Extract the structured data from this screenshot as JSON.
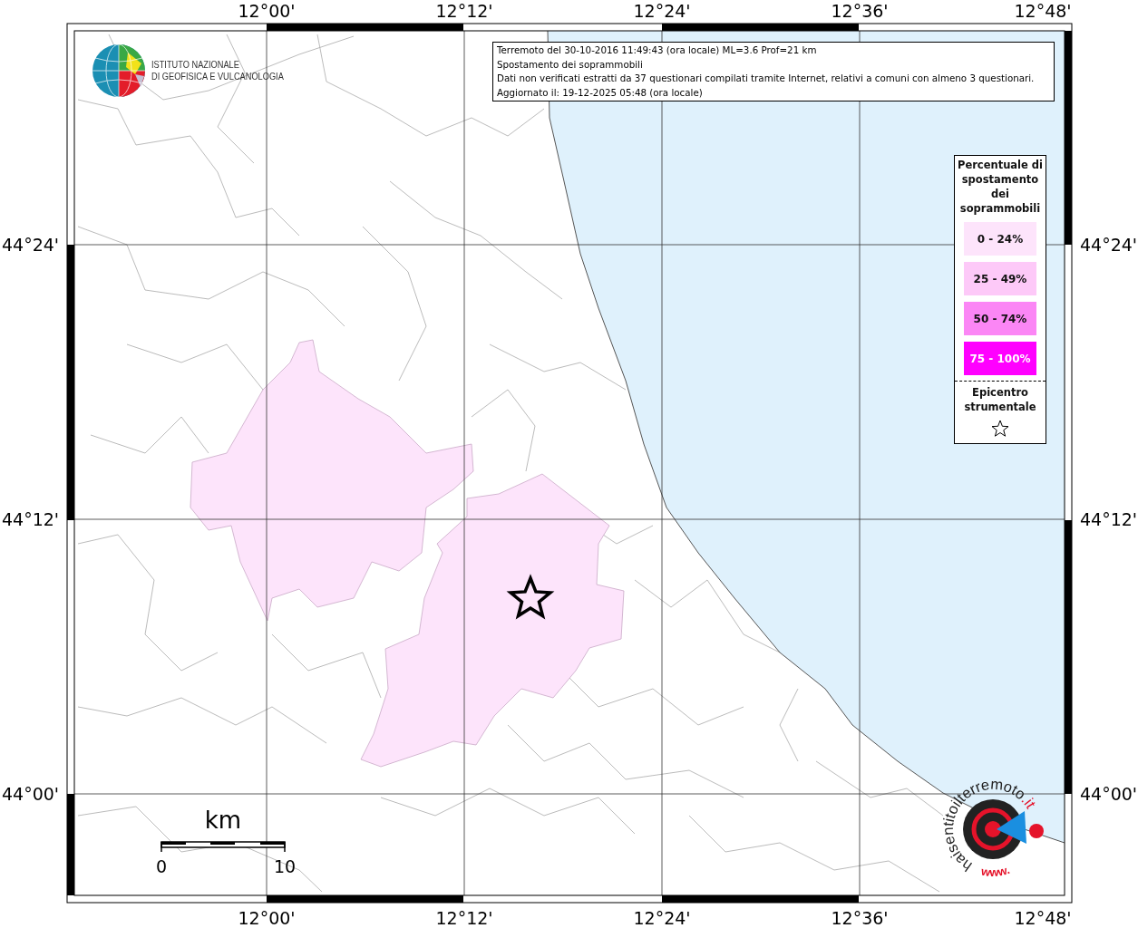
{
  "map": {
    "x_labels_top": [
      "12°00'",
      "12°12'",
      "12°24'",
      "12°36'",
      "12°48'"
    ],
    "y_labels_left": [
      "44°24'",
      "44°12'",
      "44°00'"
    ],
    "y_labels_right": [
      "44°24'",
      "44°12'",
      "44°00'"
    ],
    "x_labels_bottom": [
      "12°00'",
      "12°12'",
      "12°24'",
      "12°36'",
      "12°48'"
    ],
    "scale_bar": {
      "unit": "km",
      "start": "0",
      "end": "10"
    }
  },
  "institute_logo": {
    "lines": [
      "ISTITUTO NAZIONALE",
      "DI GEOFISICA E VULCANOLOGIA"
    ]
  },
  "info_box": {
    "lines": [
      "Terremoto del 30-10-2016 11:49:43 (ora locale) ML=3.6 Prof=21 km",
      "Spostamento dei soprammobili",
      "Dati non verificati estratti da 37 questionari compilati tramite Internet, relativi a comuni con almeno 3 questionari.",
      "Aggiornato il: 19-12-2025 05:48 (ora locale)"
    ]
  },
  "legend": {
    "title": "Percentuale di spostamento dei soprammobili",
    "items": [
      {
        "label": "0 - 24%",
        "color": "#fde4fb"
      },
      {
        "label": "25 - 49%",
        "color": "#fdc9f8"
      },
      {
        "label": "50 - 74%",
        "color": "#fb86f5"
      },
      {
        "label": "75 - 100%",
        "color": "#ff00ff"
      }
    ],
    "epicenter_label": "Epicentro strumentale"
  },
  "survey_logo": {
    "name": "haisentitoilterremoto",
    "domain": ".it",
    "prefix": "www."
  }
}
